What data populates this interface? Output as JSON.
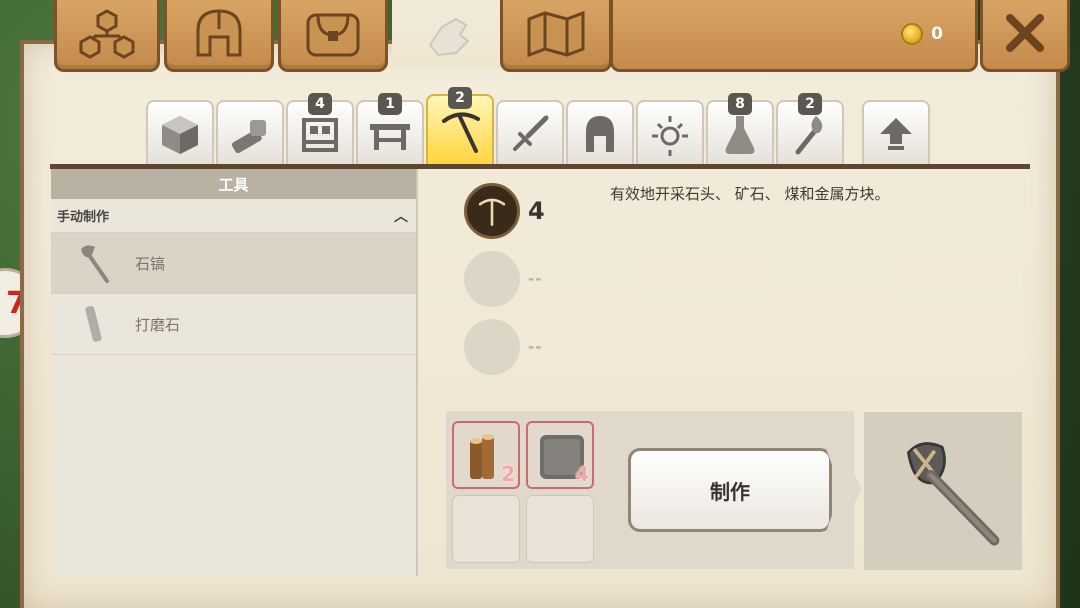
{
  "topbar": {
    "tabs": [
      {
        "icon": "skill-tree-icon"
      },
      {
        "icon": "helmet-icon"
      },
      {
        "icon": "backpack-icon"
      },
      {
        "icon": "crafting-hand-icon",
        "active": true
      },
      {
        "icon": "map-icon"
      }
    ],
    "coins": "0",
    "coin_icon": "gold-coin-icon",
    "close_icon": "close-icon"
  },
  "categories": [
    {
      "icon": "block-icon",
      "badge": ""
    },
    {
      "icon": "materials-icon",
      "badge": ""
    },
    {
      "icon": "furniture-icon",
      "badge": "4"
    },
    {
      "icon": "workbench-icon",
      "badge": "1"
    },
    {
      "icon": "pickaxe-icon",
      "badge": "2",
      "active": true
    },
    {
      "icon": "sword-icon",
      "badge": ""
    },
    {
      "icon": "helmet-icon",
      "badge": ""
    },
    {
      "icon": "sparkle-icon",
      "badge": ""
    },
    {
      "icon": "potion-icon",
      "badge": "8"
    },
    {
      "icon": "torch-icon",
      "badge": "2"
    },
    {
      "icon": "upgrade-arrow-icon",
      "badge": ""
    }
  ],
  "left_panel": {
    "title": "工具",
    "section": "手动制作",
    "recipes": [
      {
        "name": "石镐",
        "icon": "stone-pickaxe-icon",
        "selected": true
      },
      {
        "name": "打磨石",
        "icon": "whetstone-icon",
        "selected": false
      }
    ]
  },
  "side_badge": "7",
  "detail": {
    "description": "有效地开采石头、 矿石、 煤和金属方块。",
    "stats": [
      {
        "value": "4",
        "icon": "pickaxe-stat-icon"
      },
      {
        "value": "--",
        "icon": ""
      },
      {
        "value": "--",
        "icon": ""
      }
    ],
    "ingredients": [
      {
        "icon": "wood-logs-icon",
        "count": "2"
      },
      {
        "icon": "stone-block-icon",
        "count": "4"
      }
    ],
    "craft_label": "制作",
    "preview_icon": "stone-pickaxe-icon"
  }
}
